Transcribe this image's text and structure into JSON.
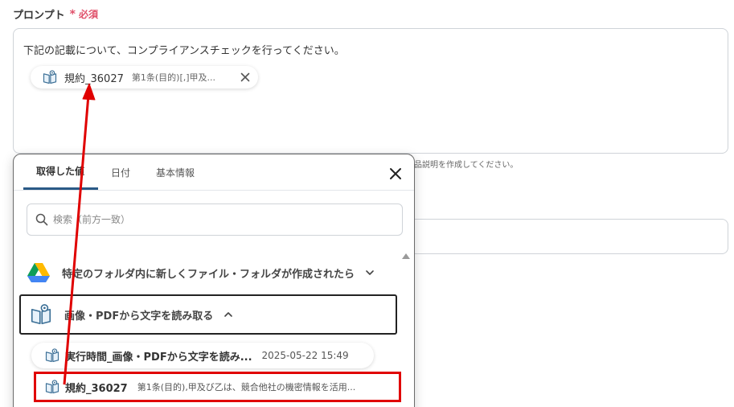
{
  "field": {
    "label": "プロンプト",
    "required_star": "*",
    "required_text": "必須"
  },
  "prompt": {
    "text": "下記の記載について、コンプライアンスチェックを行ってください。",
    "chip": {
      "name": "規約_36027",
      "value": "第1条(目的)[,]甲及..."
    }
  },
  "helper_text": "商品説明を作成してください。",
  "popup": {
    "tabs": [
      {
        "label": "取得した値"
      },
      {
        "label": "日付"
      },
      {
        "label": "基本情報"
      }
    ],
    "search_placeholder": "検索（前方一致）",
    "groups": [
      {
        "label": "特定のフォルダ内に新しくファイル・フォルダが作成されたら",
        "icon": "google-drive-icon",
        "expanded": false
      },
      {
        "label": "画像・PDFから文字を読み取る",
        "icon": "ocr-book-icon",
        "expanded": true
      }
    ],
    "items": [
      {
        "name": "実行時間_画像・PDFから文字を読み...",
        "value": "2025-05-22 15:49"
      },
      {
        "name": "規約_36027",
        "value": "第1条(目的),甲及び乙は、競合他社の機密情報を活用..."
      }
    ]
  },
  "colors": {
    "required": "#e0506a",
    "tab_active_underline": "#2a5a86",
    "highlight_box": "#e00000",
    "annotation_arrow": "#e00000"
  }
}
